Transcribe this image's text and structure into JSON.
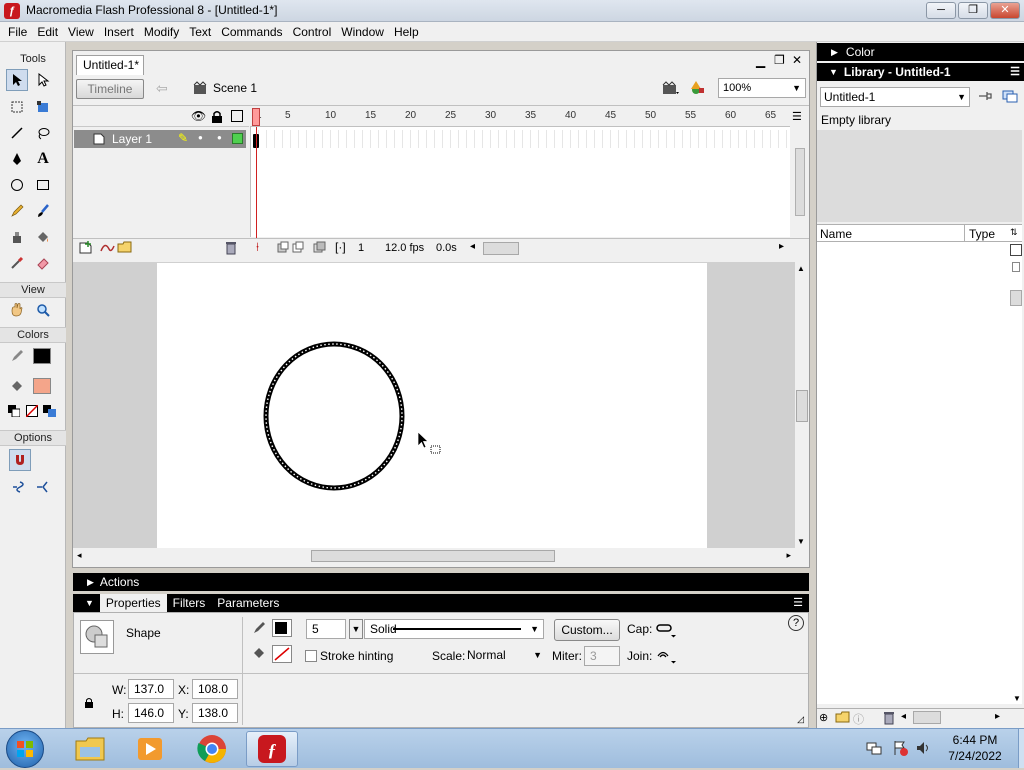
{
  "window": {
    "title": "Macromedia Flash Professional 8 - [Untitled-1*]",
    "min": "─",
    "max": "❐",
    "close": "✕"
  },
  "menu": [
    "File",
    "Edit",
    "View",
    "Insert",
    "Modify",
    "Text",
    "Commands",
    "Control",
    "Window",
    "Help"
  ],
  "tools": {
    "label": "Tools",
    "view_label": "View",
    "colors_label": "Colors",
    "options_label": "Options"
  },
  "document": {
    "tab": "Untitled-1*",
    "timeline_button": "Timeline",
    "scene": "Scene 1",
    "zoom": "100%"
  },
  "timeline": {
    "layer_name": "Layer 1",
    "ruler_ticks": [
      "1",
      "5",
      "10",
      "15",
      "20",
      "25",
      "30",
      "35",
      "40",
      "45",
      "50",
      "55",
      "60",
      "65"
    ],
    "current_frame": "1",
    "fps": "12.0 fps",
    "time": "0.0s"
  },
  "actions_panel": {
    "label": "Actions"
  },
  "properties": {
    "tabs": [
      "Properties",
      "Filters",
      "Parameters"
    ],
    "object_type": "Shape",
    "stroke_height": "5",
    "stroke_style": "Solid",
    "custom_button": "Custom...",
    "cap_label": "Cap:",
    "stroke_hinting_label": "Stroke hinting",
    "scale_label": "Scale:",
    "scale_value": "Normal",
    "miter_label": "Miter:",
    "miter_value": "3",
    "join_label": "Join:",
    "w_label": "W:",
    "w": "137.0",
    "x_label": "X:",
    "x": "108.0",
    "h_label": "H:",
    "h": "146.0",
    "y_label": "Y:",
    "y": "138.0",
    "help": "?"
  },
  "right_panel": {
    "color_header": "Color",
    "library_header": "Library - Untitled-1",
    "library_select": "Untitled-1",
    "empty_library": "Empty library",
    "col_name": "Name",
    "col_type": "Type"
  },
  "taskbar": {
    "time": "6:44 PM",
    "date": "7/24/2022"
  },
  "colors": {
    "stroke": "#000000",
    "fill": "#f4a58a",
    "flash_red": "#c8181e"
  }
}
